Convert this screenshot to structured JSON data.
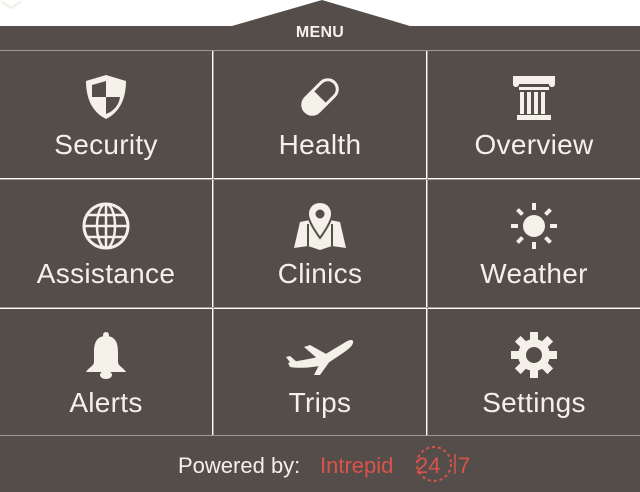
{
  "menu": {
    "label": "MENU",
    "chevron_icon": "chevron-down-icon"
  },
  "tiles": [
    {
      "label": "Security",
      "icon": "shield-icon"
    },
    {
      "label": "Health",
      "icon": "pill-icon"
    },
    {
      "label": "Overview",
      "icon": "column-icon"
    },
    {
      "label": "Assistance",
      "icon": "globe-icon"
    },
    {
      "label": "Clinics",
      "icon": "map-pin-icon"
    },
    {
      "label": "Weather",
      "icon": "sun-icon"
    },
    {
      "label": "Alerts",
      "icon": "bell-icon"
    },
    {
      "label": "Trips",
      "icon": "airplane-icon"
    },
    {
      "label": "Settings",
      "icon": "gear-icon"
    }
  ],
  "footer": {
    "powered_by": "Powered by:",
    "brand": "Intrepid",
    "brand_num": "24",
    "brand_seven": "7"
  },
  "colors": {
    "panel": "#554d4a",
    "divider": "#9e9893",
    "text": "#f4f1e9",
    "brand": "#d9534a"
  }
}
